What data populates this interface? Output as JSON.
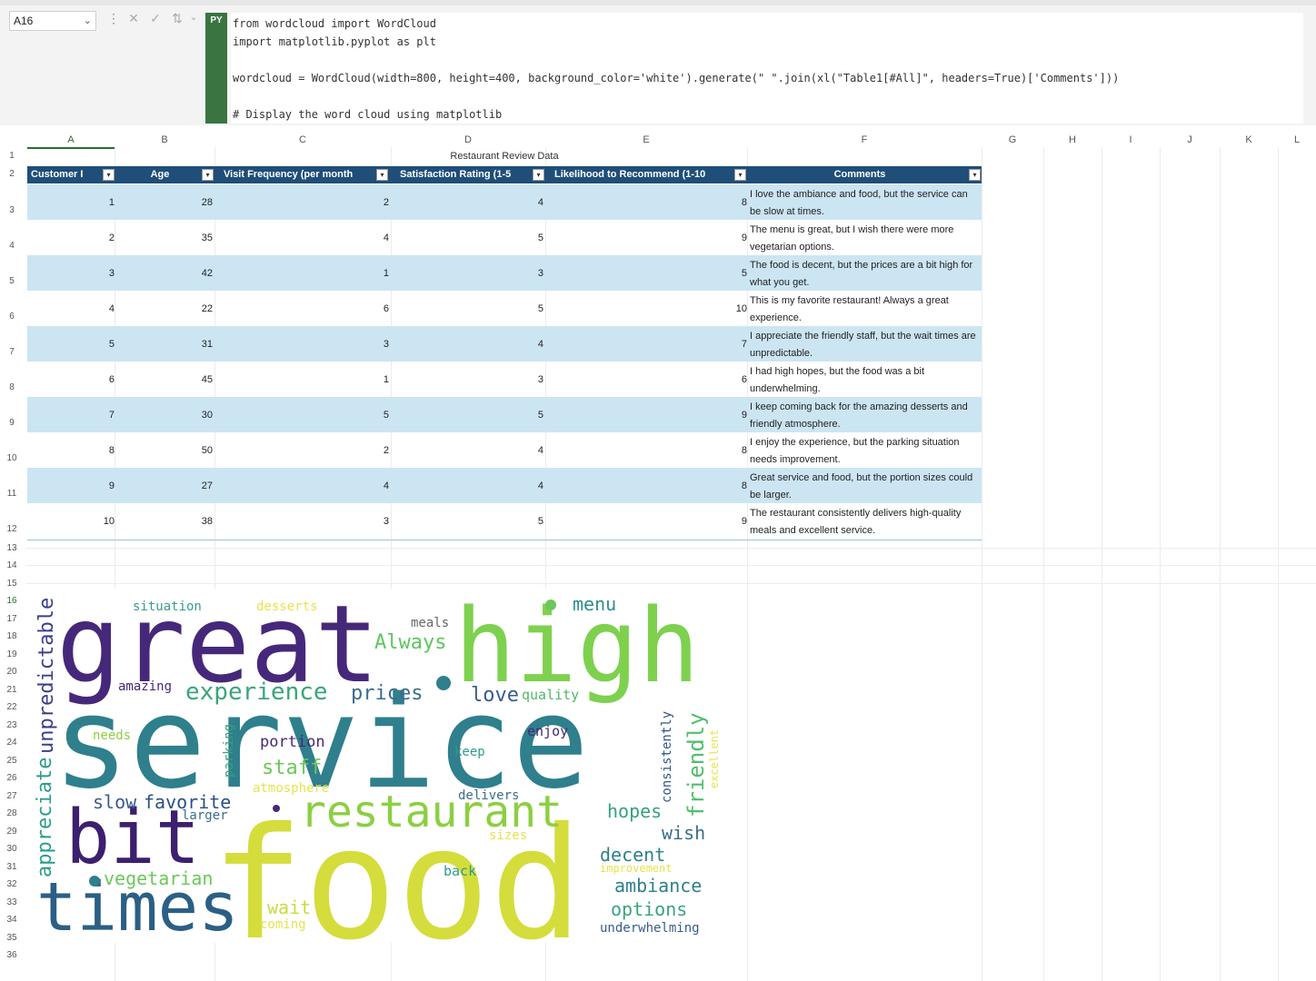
{
  "namebox": {
    "cell": "A16"
  },
  "formula_icons": {
    "cancel": "✕",
    "enter": "✓",
    "insert": "⇅"
  },
  "python": {
    "badge": "PY",
    "code_lines": [
      "from wordcloud import WordCloud",
      "import matplotlib.pyplot as plt",
      "",
      "wordcloud = WordCloud(width=800, height=400, background_color='white').generate(\" \".join(xl(\"Table1[#All]\", headers=True)['Comments']))",
      "",
      "# Display the word cloud using matplotlib"
    ]
  },
  "columns": [
    "A",
    "B",
    "C",
    "D",
    "E",
    "F",
    "G",
    "H",
    "I",
    "J",
    "K",
    "L"
  ],
  "rows": [
    "1",
    "2",
    "3",
    "4",
    "5",
    "6",
    "7",
    "8",
    "9",
    "10",
    "11",
    "12",
    "13",
    "14",
    "15",
    "16",
    "17",
    "18",
    "19",
    "20",
    "21",
    "22",
    "23",
    "24",
    "25",
    "26",
    "27",
    "28",
    "29",
    "30",
    "31",
    "32",
    "33",
    "34",
    "35",
    "36"
  ],
  "table": {
    "title": "Restaurant Review Data",
    "headers": [
      "Customer I",
      "Age",
      "Visit Frequency (per month",
      "Satisfaction Rating (1-5",
      "Likelihood to Recommend (1-10",
      "Comments"
    ],
    "rows": [
      {
        "id": "1",
        "age": "28",
        "visits": "2",
        "satisfaction": "4",
        "recommend": "8",
        "comment": "I love the ambiance and food, but the service can be slow at times."
      },
      {
        "id": "2",
        "age": "35",
        "visits": "4",
        "satisfaction": "5",
        "recommend": "9",
        "comment": "The menu is great, but I wish there were more vegetarian options."
      },
      {
        "id": "3",
        "age": "42",
        "visits": "1",
        "satisfaction": "3",
        "recommend": "5",
        "comment": "The food is decent, but the prices are a bit high for what you get."
      },
      {
        "id": "4",
        "age": "22",
        "visits": "6",
        "satisfaction": "5",
        "recommend": "10",
        "comment": "This is my favorite restaurant! Always a great experience."
      },
      {
        "id": "5",
        "age": "31",
        "visits": "3",
        "satisfaction": "4",
        "recommend": "7",
        "comment": "I appreciate the friendly staff, but the wait times are unpredictable."
      },
      {
        "id": "6",
        "age": "45",
        "visits": "1",
        "satisfaction": "3",
        "recommend": "6",
        "comment": "I had high hopes, but the food was a bit underwhelming."
      },
      {
        "id": "7",
        "age": "30",
        "visits": "5",
        "satisfaction": "5",
        "recommend": "9",
        "comment": "I keep coming back for the amazing desserts and friendly atmosphere."
      },
      {
        "id": "8",
        "age": "50",
        "visits": "2",
        "satisfaction": "4",
        "recommend": "8",
        "comment": "I enjoy the experience, but the parking situation needs improvement."
      },
      {
        "id": "9",
        "age": "27",
        "visits": "4",
        "satisfaction": "4",
        "recommend": "8",
        "comment": "Great service and food, but the portion sizes could be larger."
      },
      {
        "id": "10",
        "age": "38",
        "visits": "3",
        "satisfaction": "5",
        "recommend": "9",
        "comment": "The restaurant consistently delivers high-quality meals and excellent service."
      }
    ]
  },
  "wordcloud_words": [
    "great",
    "high",
    "service",
    "food",
    "bit",
    "times",
    "restaurant",
    "experience",
    "prices",
    "love",
    "quality",
    "menu",
    "Always",
    "meals",
    "situation",
    "desserts",
    "amazing",
    "unpredictable",
    "appreciate",
    "needs",
    "portion",
    "parking",
    "staff",
    "atmosphere",
    "slow",
    "favorite",
    "larger",
    "delivers",
    "hopes",
    "wish",
    "decent",
    "improvement",
    "ambiance",
    "options",
    "underwhelming",
    "vegetarian",
    "wait",
    "coming",
    "back",
    "sizes",
    "keep",
    "enjoy",
    "consistently",
    "friendly",
    "excellent"
  ]
}
